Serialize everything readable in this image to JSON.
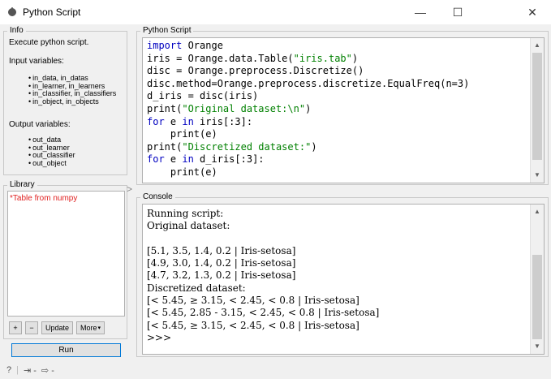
{
  "window": {
    "title": "Python Script",
    "minimize": "—",
    "maximize": "☐",
    "close": "✕"
  },
  "info": {
    "label": "Info",
    "description": "Execute python script.",
    "input_heading": "Input variables:",
    "inputs": [
      "in_data, in_datas",
      "in_learner, in_learners",
      "in_classifier, in_classifiers",
      "in_object, in_objects"
    ],
    "output_heading": "Output variables:",
    "outputs": [
      "out_data",
      "out_learner",
      "out_classifier",
      "out_object"
    ]
  },
  "library": {
    "label": "Library",
    "items": [
      "*Table from numpy"
    ],
    "add": "+",
    "remove": "−",
    "update": "Update",
    "more": "More"
  },
  "run_label": "Run",
  "script": {
    "label": "Python Script",
    "lines": [
      [
        {
          "k": "kw",
          "t": "import"
        },
        {
          "t": " Orange"
        }
      ],
      [
        {
          "t": "iris = Orange.data.Table("
        },
        {
          "k": "str",
          "t": "\"iris.tab\""
        },
        {
          "t": ")"
        }
      ],
      [
        {
          "t": "disc = Orange.preprocess.Discretize()"
        }
      ],
      [
        {
          "t": "disc.method=Orange.preprocess.discretize.EqualFreq(n=3)"
        }
      ],
      [
        {
          "t": "d_iris = disc(iris)"
        }
      ],
      [
        {
          "t": "print("
        },
        {
          "k": "str",
          "t": "\"Original dataset:\\n\""
        },
        {
          "t": ")"
        }
      ],
      [
        {
          "k": "kw",
          "t": "for"
        },
        {
          "t": " e "
        },
        {
          "k": "kw",
          "t": "in"
        },
        {
          "t": " iris[:3]:"
        }
      ],
      [
        {
          "t": "    print(e)"
        }
      ],
      [
        {
          "t": "print("
        },
        {
          "k": "str",
          "t": "\"Discretized dataset:\""
        },
        {
          "t": ")"
        }
      ],
      [
        {
          "k": "kw",
          "t": "for"
        },
        {
          "t": " e "
        },
        {
          "k": "kw",
          "t": "in"
        },
        {
          "t": " d_iris[:3]:"
        }
      ],
      [
        {
          "t": "    print(e)"
        }
      ]
    ]
  },
  "console": {
    "label": "Console",
    "lines": [
      "Running script:",
      "Original dataset:",
      "",
      "[5.1, 3.5, 1.4, 0.2 | Iris-setosa]",
      "[4.9, 3.0, 1.4, 0.2 | Iris-setosa]",
      "[4.7, 3.2, 1.3, 0.2 | Iris-setosa]",
      "Discretized dataset:",
      "[< 5.45, ≥ 3.15, < 2.45, < 0.8 | Iris-setosa]",
      "[< 5.45, 2.85 - 3.15, < 2.45, < 0.8 | Iris-setosa]",
      "[< 5.45, ≥ 3.15, < 2.45, < 0.8 | Iris-setosa]",
      ">>>"
    ]
  },
  "status": {
    "help": "?",
    "input": "⇥ -",
    "output": "⇨ -"
  },
  "colors": {
    "keyword": "#0000c0",
    "string": "#008000",
    "library_item": "#e02020",
    "run_border": "#0078d7"
  }
}
